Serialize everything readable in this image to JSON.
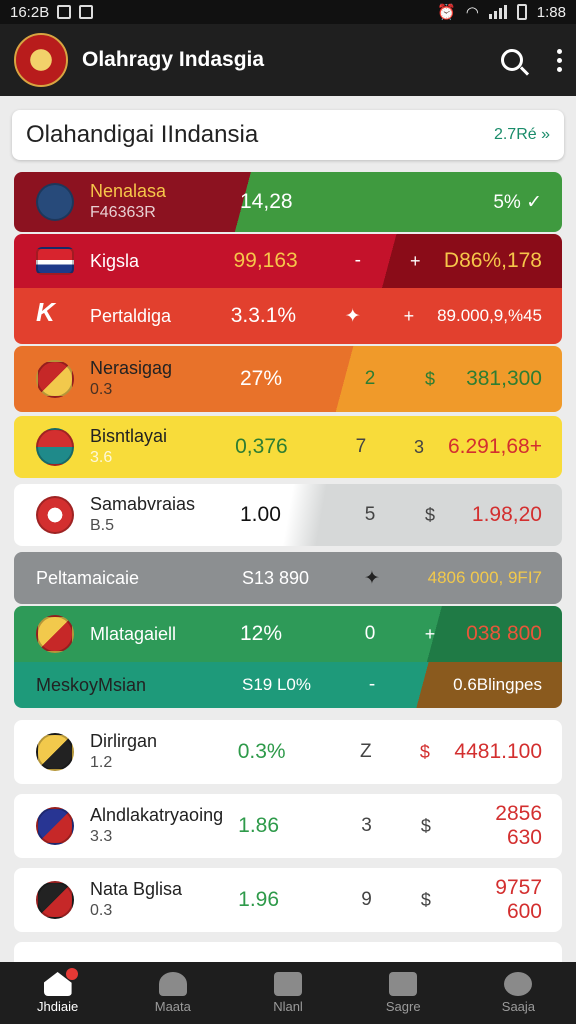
{
  "status": {
    "time_left": "16:2B",
    "time_right": "1:88"
  },
  "app": {
    "title": "Olahragy Indasgia"
  },
  "header": {
    "title": "Olahandigai IIndansia",
    "right": "2.7Ré »"
  },
  "rows": [
    {
      "name": "Nenalasa",
      "sub": "F46363R",
      "v1": "14,28",
      "v2": "",
      "v3": "",
      "v4": "5% ✓"
    },
    {
      "name": "Kigsla",
      "sub": "",
      "v1": "99,163",
      "v2": "-",
      "v3": "+",
      "v4": "D86%,178"
    },
    {
      "name": "Pertaldiga",
      "sub": "",
      "v1": "3.3.1%",
      "v2": "✦",
      "v3": "+",
      "v4": "89.000,9,%45"
    },
    {
      "name": "Nerasigag",
      "sub": "0.3",
      "v1": "27%",
      "v2": "2",
      "v3": "$",
      "v4": "381,300"
    },
    {
      "name": "Bisntlayai",
      "sub": "3.6",
      "v1": "0,376",
      "v2": "7",
      "v3": "3",
      "v4": "6.291,68+"
    },
    {
      "name": "Samabvraias",
      "sub": "B.5",
      "v1": "1.00",
      "v2": "5",
      "v3": "$",
      "v4": "1.98,20"
    },
    {
      "name": "Peltamaicaie",
      "sub": "",
      "v1": "S13 890",
      "v2": "✦",
      "v3": "",
      "v4": "4806 000, 9FI7"
    },
    {
      "name": "Mlatagaiell",
      "sub": "",
      "v1": "12%",
      "v2": "0",
      "v3": "+",
      "v4": "038 800"
    },
    {
      "name": "MeskoyMsian",
      "sub": "",
      "v1": "S19 L0%",
      "v2": "-",
      "v3": "",
      "v4": "0.6Blingpes"
    },
    {
      "name": "Dirlirgan",
      "sub": "1.2",
      "v1": "0.3%",
      "v2": "Z",
      "v3": "$",
      "v4": "4481.100"
    },
    {
      "name": "Alndlakatryaoing",
      "sub": "3.3",
      "v1": "1.86",
      "v2": "3",
      "v3": "$",
      "v4": "2856 630"
    },
    {
      "name": "Nata Bglisa",
      "sub": "0.3",
      "v1": "1.96",
      "v2": "9",
      "v3": "$",
      "v4": "9757 600"
    }
  ],
  "nav": [
    {
      "label": "Jhdiaie",
      "icon": "home-icon"
    },
    {
      "label": "Maata",
      "icon": "profile-icon"
    },
    {
      "label": "Nlanl",
      "icon": "cards-icon"
    },
    {
      "label": "Sagre",
      "icon": "store-icon"
    },
    {
      "label": "Saaja",
      "icon": "user-icon"
    }
  ]
}
